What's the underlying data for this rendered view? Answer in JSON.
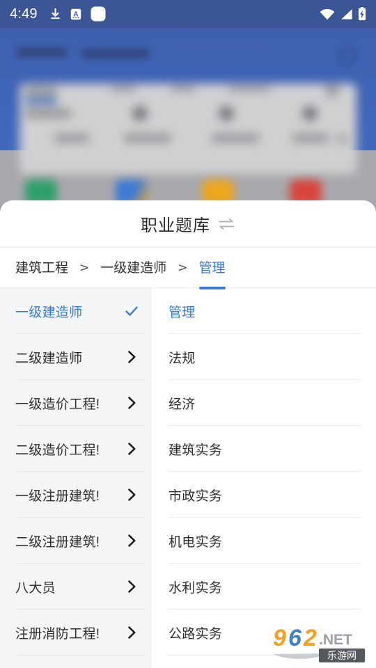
{
  "status_bar": {
    "time": "4:49",
    "left_icons": [
      "download-icon",
      "translate-a-icon",
      "rounded-square-icon"
    ],
    "right_icons": [
      "wifi-icon",
      "cellular-signal-icon",
      "battery-charging-icon"
    ],
    "background_color": "#3c5595",
    "text_color": "#ffffff"
  },
  "sheet": {
    "title": "职业题库",
    "title_icon": "swap-horizontal-icon",
    "accent_color": "#3a7bd8",
    "background_color": "#ffffff"
  },
  "breadcrumb": {
    "separator": ">",
    "items": [
      {
        "label": "建筑工程",
        "active": false
      },
      {
        "label": "一级建造师",
        "active": false
      },
      {
        "label": "管理",
        "active": true
      }
    ]
  },
  "left_panel": {
    "background_color": "#f4f5f7",
    "items": [
      {
        "label": "一级建造师",
        "selected": true,
        "icon": "check-icon"
      },
      {
        "label": "二级建造师",
        "selected": false,
        "icon": "chevron-right-icon"
      },
      {
        "label": "一级造价工程!",
        "selected": false,
        "icon": "chevron-right-icon"
      },
      {
        "label": "二级造价工程!",
        "selected": false,
        "icon": "chevron-right-icon"
      },
      {
        "label": "一级注册建筑!",
        "selected": false,
        "icon": "chevron-right-icon"
      },
      {
        "label": "二级注册建筑!",
        "selected": false,
        "icon": "chevron-right-icon"
      },
      {
        "label": "八大员",
        "selected": false,
        "icon": "chevron-right-icon"
      },
      {
        "label": "注册消防工程!",
        "selected": false,
        "icon": "chevron-right-icon"
      }
    ]
  },
  "right_panel": {
    "background_color": "#ffffff",
    "items": [
      {
        "label": "管理",
        "selected": true
      },
      {
        "label": "法规",
        "selected": false
      },
      {
        "label": "经济",
        "selected": false
      },
      {
        "label": "建筑实务",
        "selected": false
      },
      {
        "label": "市政实务",
        "selected": false
      },
      {
        "label": "机电实务",
        "selected": false
      },
      {
        "label": "水利实务",
        "selected": false
      },
      {
        "label": "公路实务",
        "selected": false
      }
    ]
  },
  "watermark": {
    "digits": "962",
    "suffix": ".NET",
    "banner_text": "乐游网",
    "color_digit_1": "#f5a01e",
    "color_digit_2": "#3d7fd0",
    "color_digit_3": "#f5a01e",
    "color_suffix": "#8d9196",
    "banner_color": "#55585c"
  }
}
